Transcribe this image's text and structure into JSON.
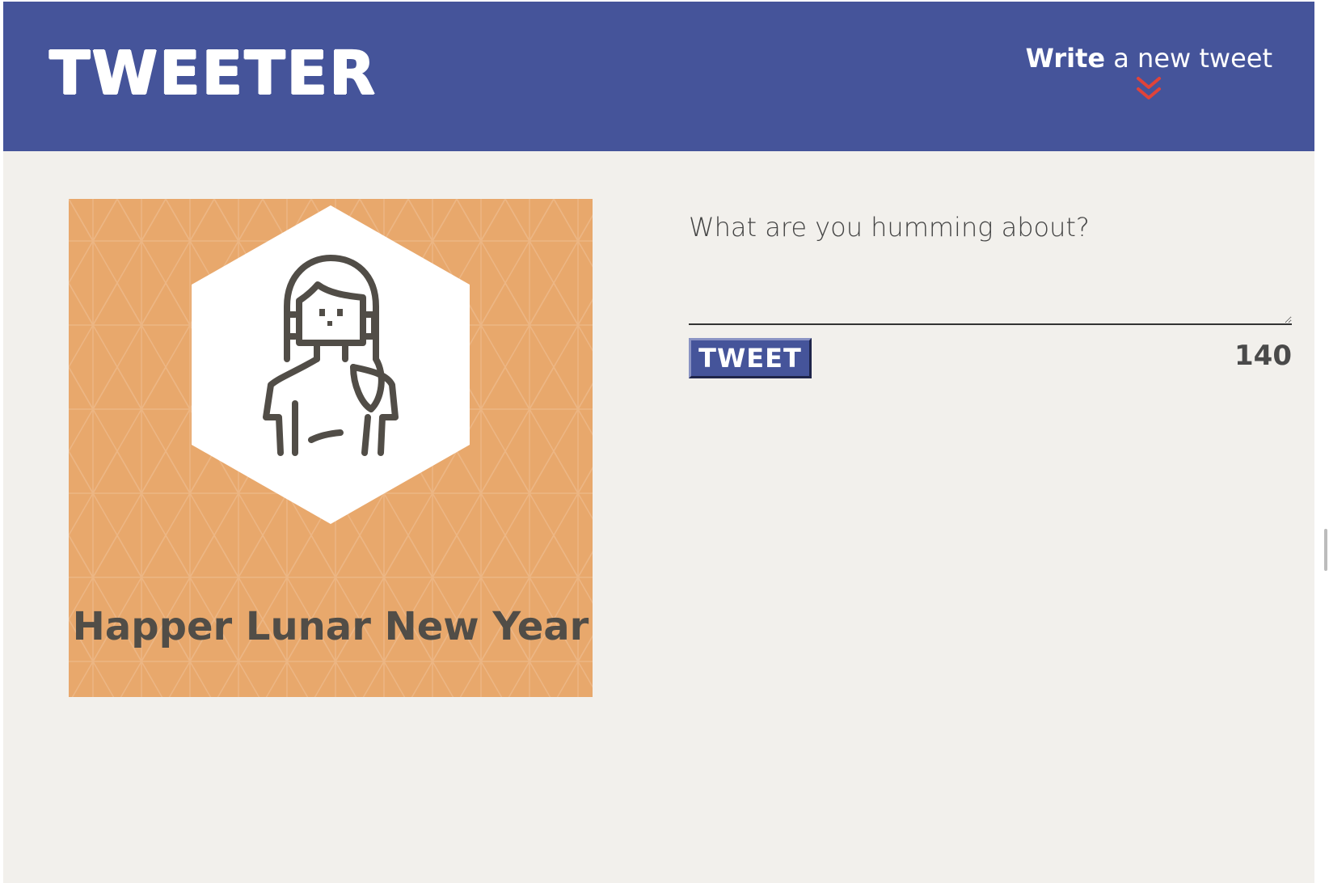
{
  "header": {
    "logo_text": "TWEETER",
    "write_toggle": {
      "bold_text": "Write",
      "rest_text": " a new tweet",
      "icon": "double-chevron-down-icon"
    }
  },
  "profile": {
    "avatar_icon": "user-avatar-icon",
    "name": "Happer Lunar New Year"
  },
  "composer": {
    "placeholder": "What are you humming about?",
    "value": "",
    "submit_label": "TWEET",
    "char_count": "140"
  },
  "colors": {
    "header_bg": "#45549a",
    "page_bg": "#f2f0ec",
    "card_bg": "#e8a86c",
    "chevron": "#e0433a",
    "text_dark": "#514d47"
  }
}
